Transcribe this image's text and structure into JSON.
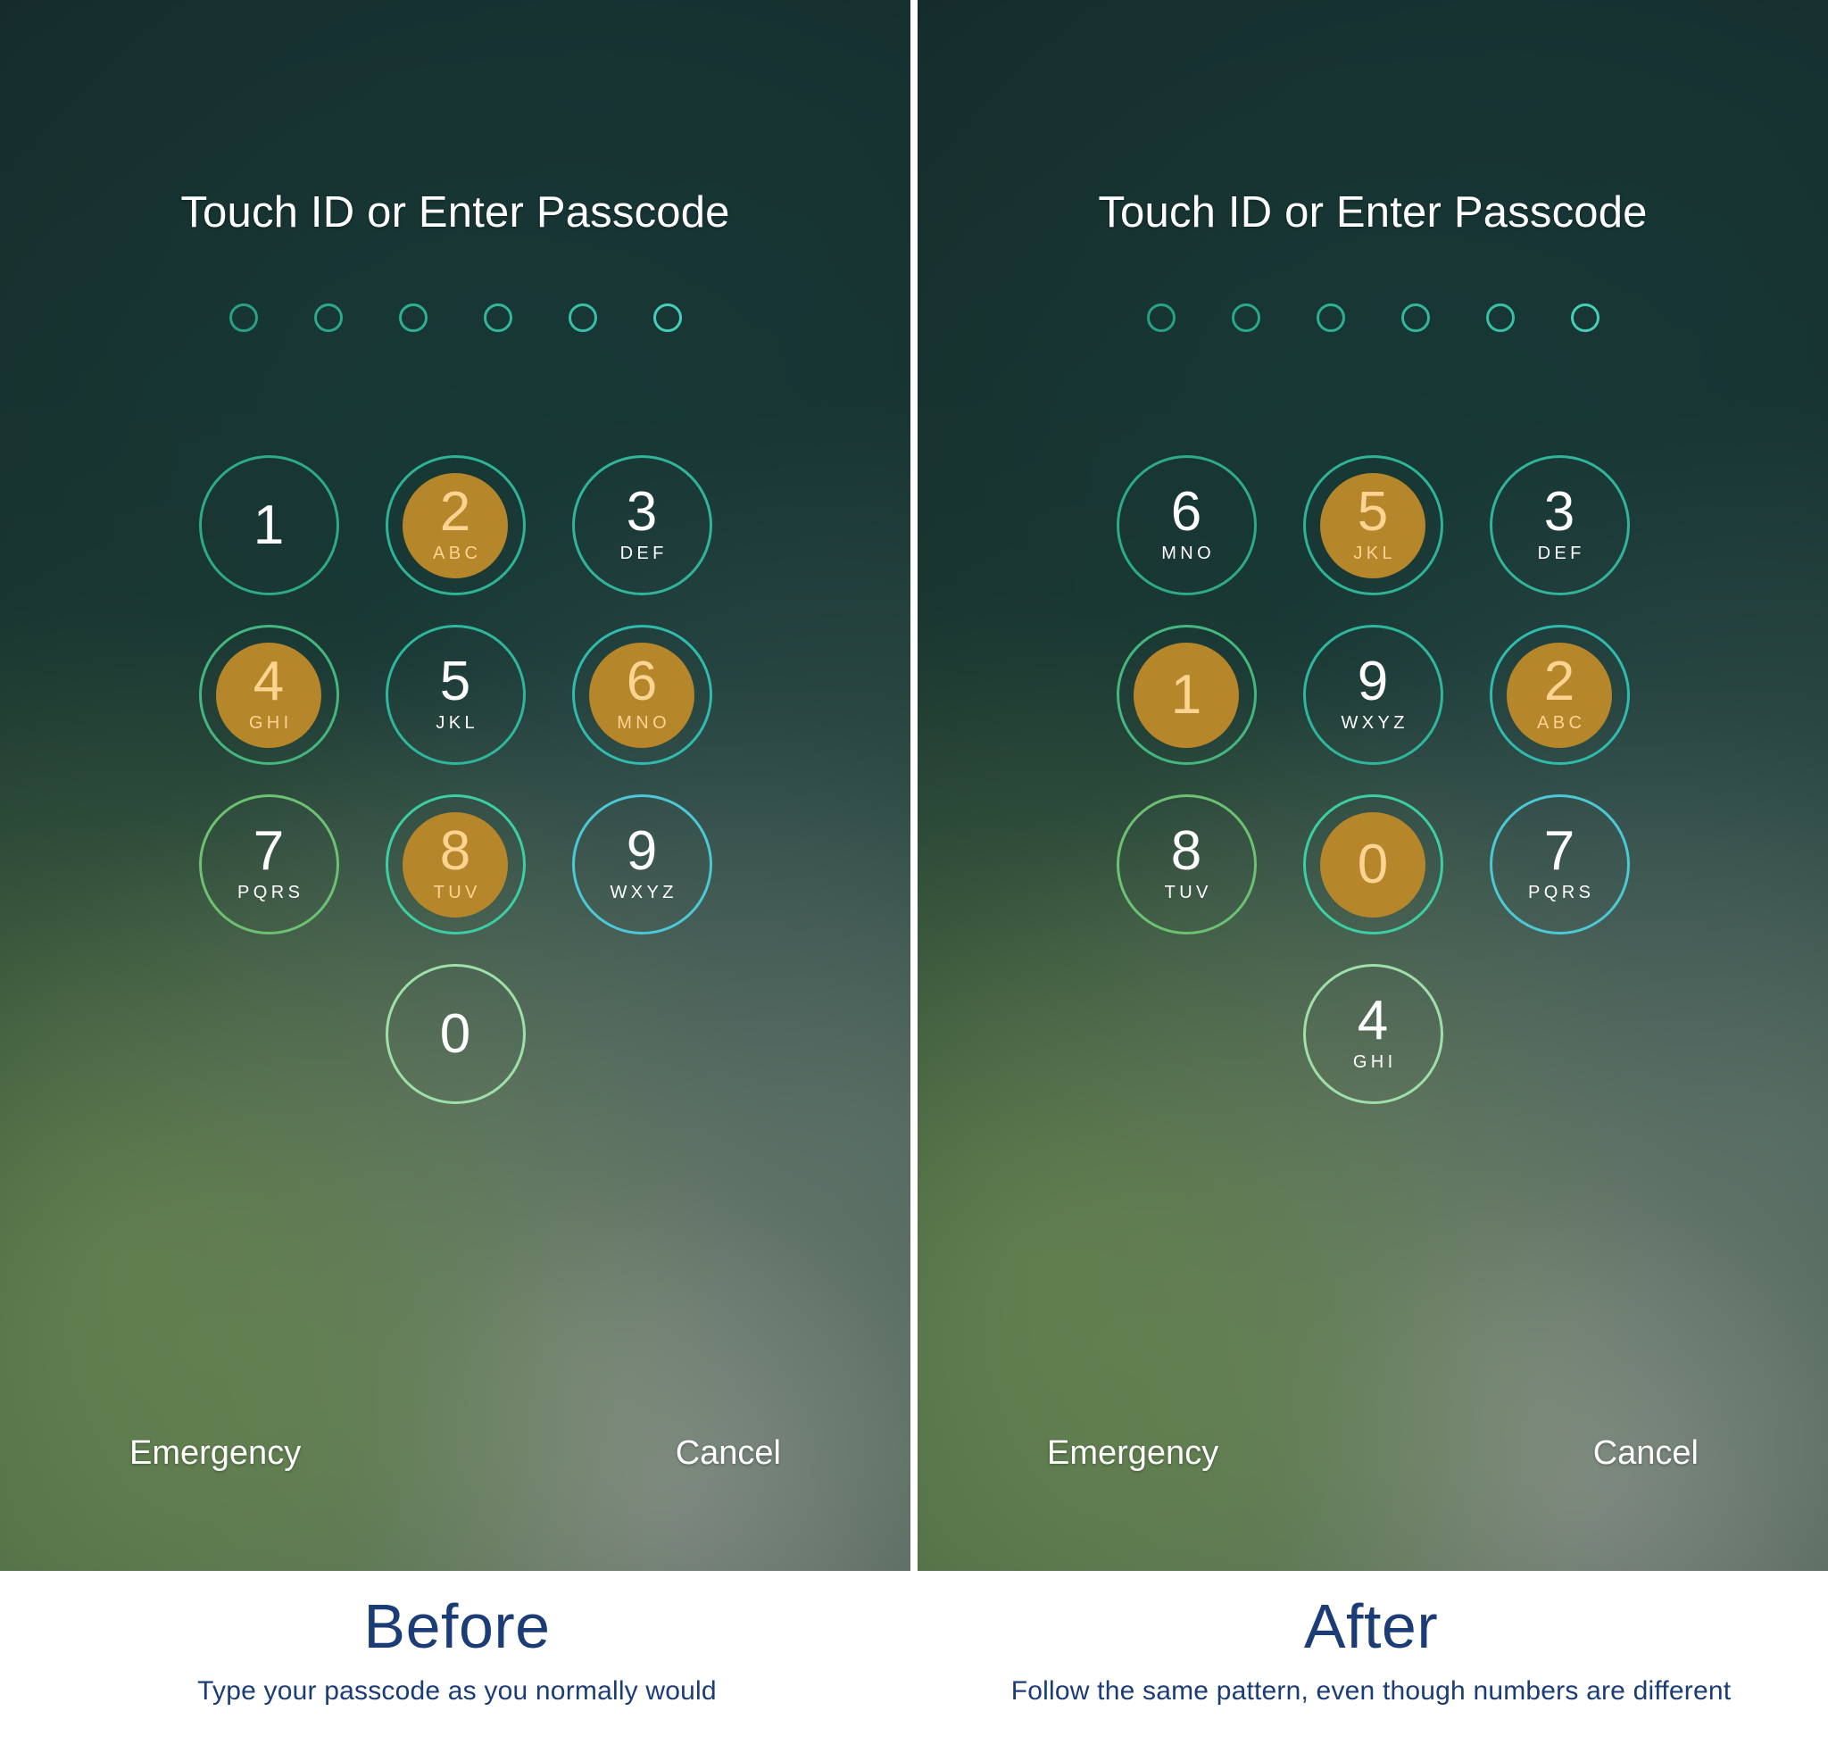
{
  "accent": {
    "ring_teal": "#2fb08f",
    "highlight_gold": "#b5862a",
    "highlight_text": "#ffd392",
    "caption_navy": "#1b3c76",
    "backdrop_dark": "#15292a"
  },
  "panels": [
    {
      "id": "before",
      "lock_title": "Touch ID or Enter Passcode",
      "passcode_dots": 6,
      "keypad": [
        [
          {
            "digit": "1",
            "letters": "",
            "selected": false
          },
          {
            "digit": "2",
            "letters": "ABC",
            "selected": true
          },
          {
            "digit": "3",
            "letters": "DEF",
            "selected": false
          }
        ],
        [
          {
            "digit": "4",
            "letters": "GHI",
            "selected": true
          },
          {
            "digit": "5",
            "letters": "JKL",
            "selected": false
          },
          {
            "digit": "6",
            "letters": "MNO",
            "selected": true
          }
        ],
        [
          {
            "digit": "7",
            "letters": "PQRS",
            "selected": false
          },
          {
            "digit": "8",
            "letters": "TUV",
            "selected": true
          },
          {
            "digit": "9",
            "letters": "WXYZ",
            "selected": false
          }
        ],
        [
          {
            "digit": "0",
            "letters": "",
            "selected": false
          }
        ]
      ],
      "emergency_label": "Emergency",
      "cancel_label": "Cancel",
      "caption_title": "Before",
      "caption_subtitle": "Type your passcode as you normally would"
    },
    {
      "id": "after",
      "lock_title": "Touch ID or Enter Passcode",
      "passcode_dots": 6,
      "keypad": [
        [
          {
            "digit": "6",
            "letters": "MNO",
            "selected": false
          },
          {
            "digit": "5",
            "letters": "JKL",
            "selected": true
          },
          {
            "digit": "3",
            "letters": "DEF",
            "selected": false
          }
        ],
        [
          {
            "digit": "1",
            "letters": "",
            "selected": true
          },
          {
            "digit": "9",
            "letters": "WXYZ",
            "selected": false
          },
          {
            "digit": "2",
            "letters": "ABC",
            "selected": true
          }
        ],
        [
          {
            "digit": "8",
            "letters": "TUV",
            "selected": false
          },
          {
            "digit": "0",
            "letters": "",
            "selected": true
          },
          {
            "digit": "7",
            "letters": "PQRS",
            "selected": false
          }
        ],
        [
          {
            "digit": "4",
            "letters": "GHI",
            "selected": false
          }
        ]
      ],
      "emergency_label": "Emergency",
      "cancel_label": "Cancel",
      "caption_title": "After",
      "caption_subtitle": "Follow the same pattern, even though numbers are different"
    }
  ]
}
